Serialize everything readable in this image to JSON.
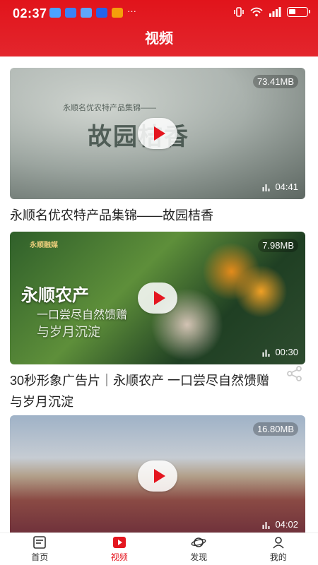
{
  "status": {
    "time": "02:37",
    "notifications": [
      "app-icon-1",
      "app-icon-2",
      "app-icon-3",
      "app-icon-4",
      "app-icon-5"
    ],
    "more": "···"
  },
  "header": {
    "title": "视频",
    "accent": "#e4161f"
  },
  "videos": [
    {
      "size": "73.41MB",
      "duration": "04:41",
      "overlay": {
        "title": "故园桔香",
        "subtitle": "永顺名优农特产品集锦——"
      },
      "caption": "永顺名优农特产品集锦——故园桔香"
    },
    {
      "size": "7.98MB",
      "duration": "00:30",
      "overlay": {
        "title": "永顺农产",
        "line1": "一口尝尽自然馈赠",
        "line2": "与岁月沉淀",
        "logo": "永顺融媒"
      },
      "caption": "30秒形象广告片｜永顺农产 一口尝尽自然馈赠与岁月沉淀"
    },
    {
      "size": "16.80MB",
      "duration": "04:02",
      "caption": ""
    }
  ],
  "nav": [
    {
      "label": "首页",
      "icon": "home-doc-icon",
      "active": false
    },
    {
      "label": "视频",
      "icon": "video-play-icon",
      "active": true
    },
    {
      "label": "发现",
      "icon": "planet-icon",
      "active": false
    },
    {
      "label": "我的",
      "icon": "user-icon",
      "active": false
    }
  ]
}
